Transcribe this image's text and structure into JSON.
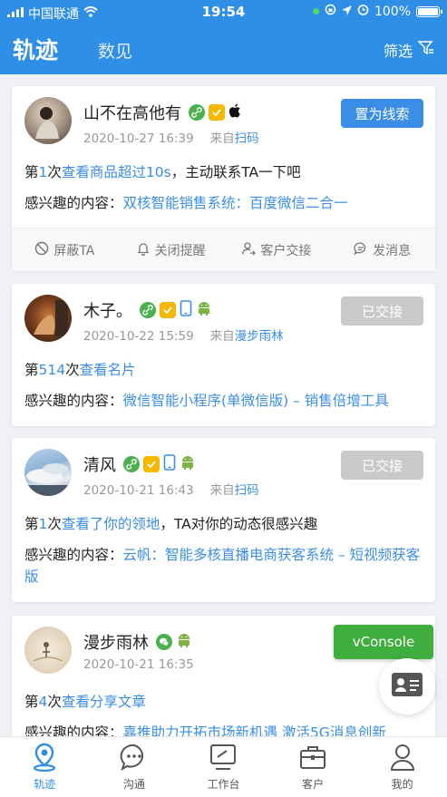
{
  "status": {
    "carrier": "中国联通",
    "time": "19:54",
    "battery": "100%"
  },
  "nav": {
    "tab_active": "轨迹",
    "tab_other": "数见",
    "filter_label": "筛选"
  },
  "cards": [
    {
      "name": "山不在高他有",
      "time": "2020-10-27 16:39",
      "from_prefix": "来自",
      "source": "扫码",
      "button": "置为线索",
      "line1": {
        "p1": "第",
        "count": "1",
        "p2": "次",
        "action": "查看商品超过10s",
        "suffix": "，主动联系TA一下吧"
      },
      "interest_label": "感兴趣的内容：",
      "interest": "双核智能销售系统：百度微信二合一",
      "actions": [
        "屏蔽TA",
        "关闭提醒",
        "客户交接",
        "发消息"
      ]
    },
    {
      "name": "木子。",
      "time": "2020-10-22 15:59",
      "from_prefix": "来自",
      "source": "漫步雨林",
      "button": "已交接",
      "line1": {
        "p1": "第",
        "count": "514",
        "p2": "次",
        "action": "查看名片",
        "suffix": ""
      },
      "interest_label": "感兴趣的内容：",
      "interest": "微信智能小程序(单微信版) – 销售倍增工具"
    },
    {
      "name": "清风",
      "time": "2020-10-21 16:43",
      "from_prefix": "来自",
      "source": "扫码",
      "button": "已交接",
      "line1": {
        "p1": "第",
        "count": "1",
        "p2": "次",
        "action": "查看了你的领地",
        "suffix": "，TA对你的动态很感兴趣"
      },
      "interest_label": "感兴趣的内容：",
      "interest": "云帆：智能多核直播电商获客系统 – 短视频获客版"
    },
    {
      "name": "漫步雨林",
      "time": "2020-10-21 16:35",
      "line1": {
        "p1": "第",
        "count": "4",
        "p2": "次",
        "action": "查看分享文章",
        "suffix": ""
      },
      "interest_label": "感兴趣的内容：",
      "interest": "嘉推助力开拓市场新机遇 激活5G消息创新"
    }
  ],
  "vconsole": "vConsole",
  "tabbar": [
    "轨迹",
    "沟通",
    "工作台",
    "客户",
    "我的"
  ],
  "colors": {
    "primary": "#2f8ee6",
    "link": "#3a8ee6",
    "disabled": "#c9c9c9",
    "vconsole": "#3eaf3e"
  }
}
